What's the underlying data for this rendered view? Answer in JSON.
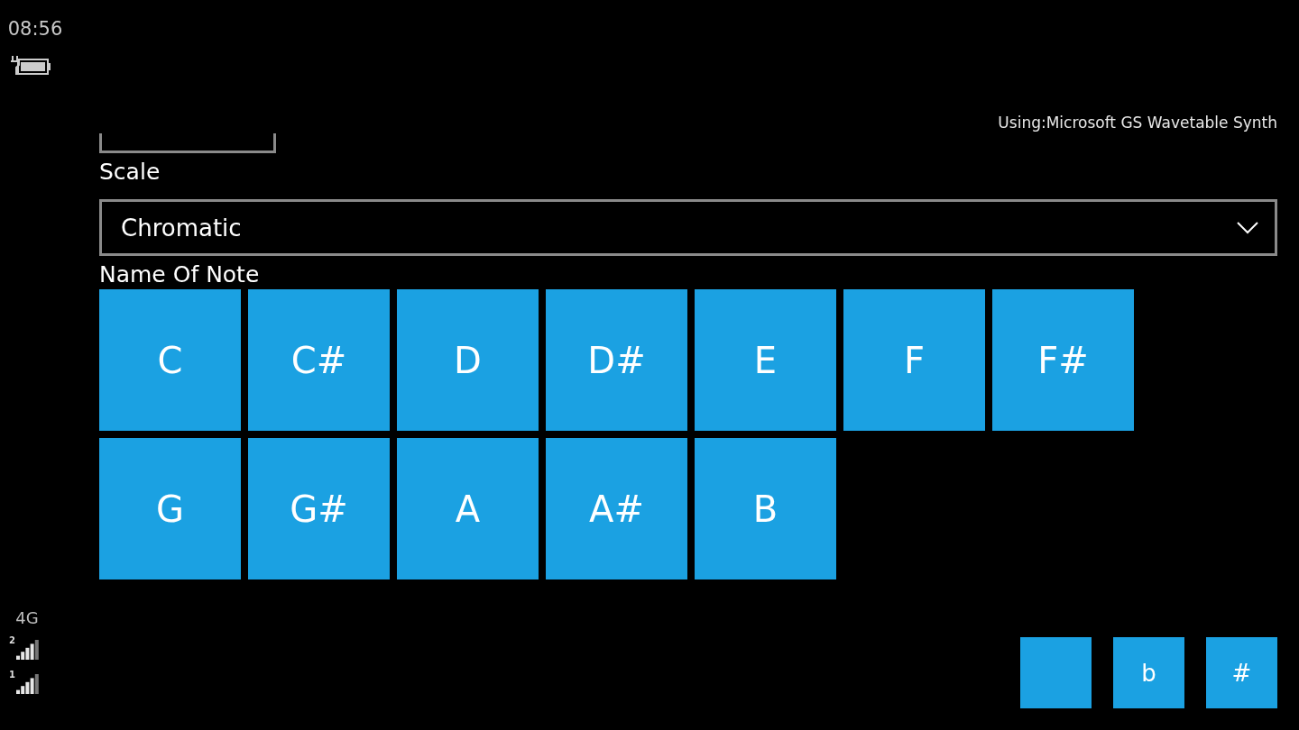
{
  "status_bar": {
    "time": "08:56",
    "network": "4G",
    "sims": [
      {
        "label": "2"
      },
      {
        "label": "1"
      }
    ]
  },
  "synth_info": "Using:Microsoft GS Wavetable Synth",
  "scale": {
    "label": "Scale",
    "value": "Chromatic"
  },
  "notes": {
    "label": "Name Of Note",
    "items": [
      "C",
      "C#",
      "D",
      "D#",
      "E",
      "F",
      "F#",
      "G",
      "G#",
      "A",
      "A#",
      "B"
    ]
  },
  "accidental_buttons": [
    {
      "kind": "blank"
    },
    {
      "kind": "text",
      "label": "b"
    },
    {
      "kind": "text",
      "label": "#"
    }
  ]
}
